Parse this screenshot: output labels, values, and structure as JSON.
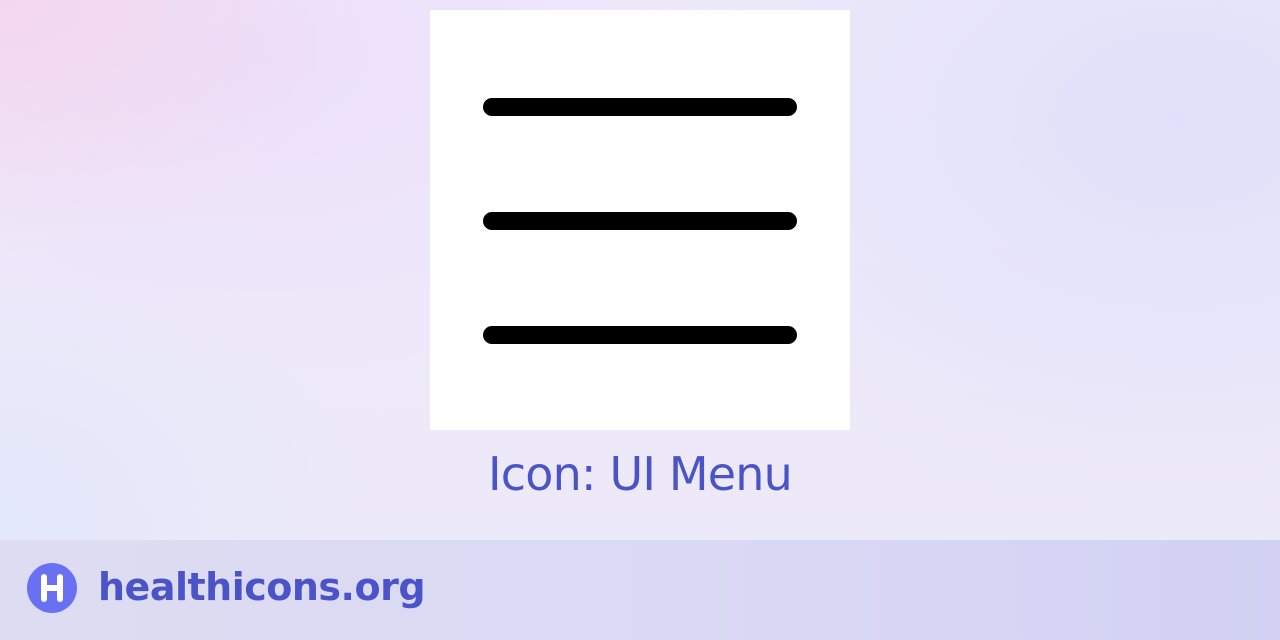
{
  "icon_card": {
    "icon_name": "menu-icon"
  },
  "caption": {
    "title": "Icon: UI Menu"
  },
  "footer": {
    "site_name": "healthicons.org"
  },
  "colors": {
    "accent": "#4a54c8",
    "logo_background": "#6a70f2",
    "icon_stroke": "#000000",
    "card_background": "#ffffff"
  }
}
